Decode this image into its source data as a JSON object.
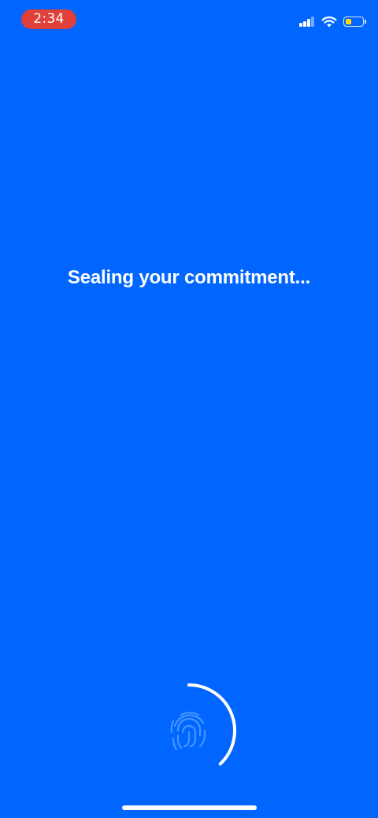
{
  "status_bar": {
    "time": "2:34",
    "time_pill_color": "#E0403A",
    "signal_icon": "cellular-signal-icon",
    "wifi_icon": "wifi-icon",
    "battery_icon": "battery-low-icon",
    "battery_level": 0.35,
    "battery_color": "#FFD60A"
  },
  "main": {
    "message": "Sealing your commitment...",
    "background_color": "#0066FF"
  },
  "hold_button": {
    "icon": "fingerprint-icon",
    "progress": 0.38,
    "ring_color": "#FFFFFF"
  }
}
